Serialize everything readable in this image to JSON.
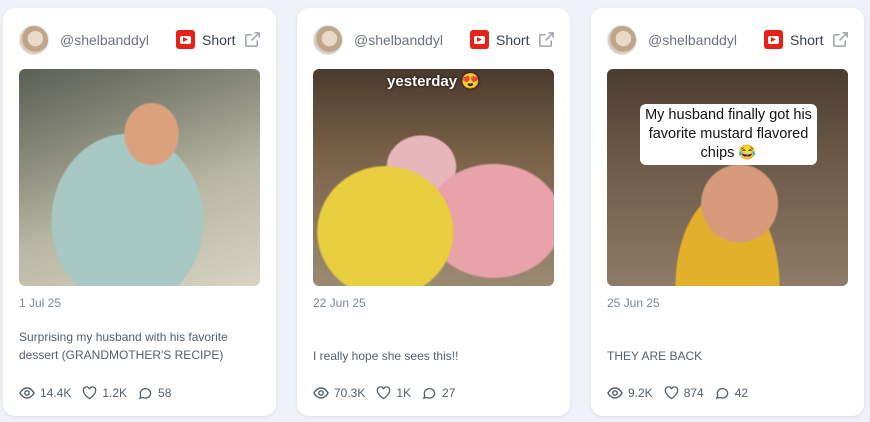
{
  "cards": [
    {
      "handle": "@shelbanddyl",
      "badge_label": "Short",
      "date": "1 Jul 25",
      "description": "Surprising my husband with his favorite dessert (GRANDMOTHER'S RECIPE)",
      "views": "14.4K",
      "likes": "1.2K",
      "comments": "58"
    },
    {
      "handle": "@shelbanddyl",
      "badge_label": "Short",
      "overlay_text": "yesterday 😍",
      "date": "22 Jun 25",
      "description": "I really hope she sees this!!",
      "views": "70.3K",
      "likes": "1K",
      "comments": "27"
    },
    {
      "handle": "@shelbanddyl",
      "badge_label": "Short",
      "overlay_text": "My husband finally got his favorite mustard flavored chips 😂",
      "date": "25 Jun 25",
      "description": "THEY ARE BACK",
      "views": "9.2K",
      "likes": "874",
      "comments": "42"
    }
  ],
  "icons": [
    "avatar",
    "youtube-icon",
    "external-link-icon",
    "eye-icon",
    "heart-icon",
    "comment-icon"
  ],
  "colors": {
    "youtube_red": "#e62117",
    "background": "#eef1f7",
    "card": "#ffffff",
    "text_muted": "#7b8794"
  }
}
